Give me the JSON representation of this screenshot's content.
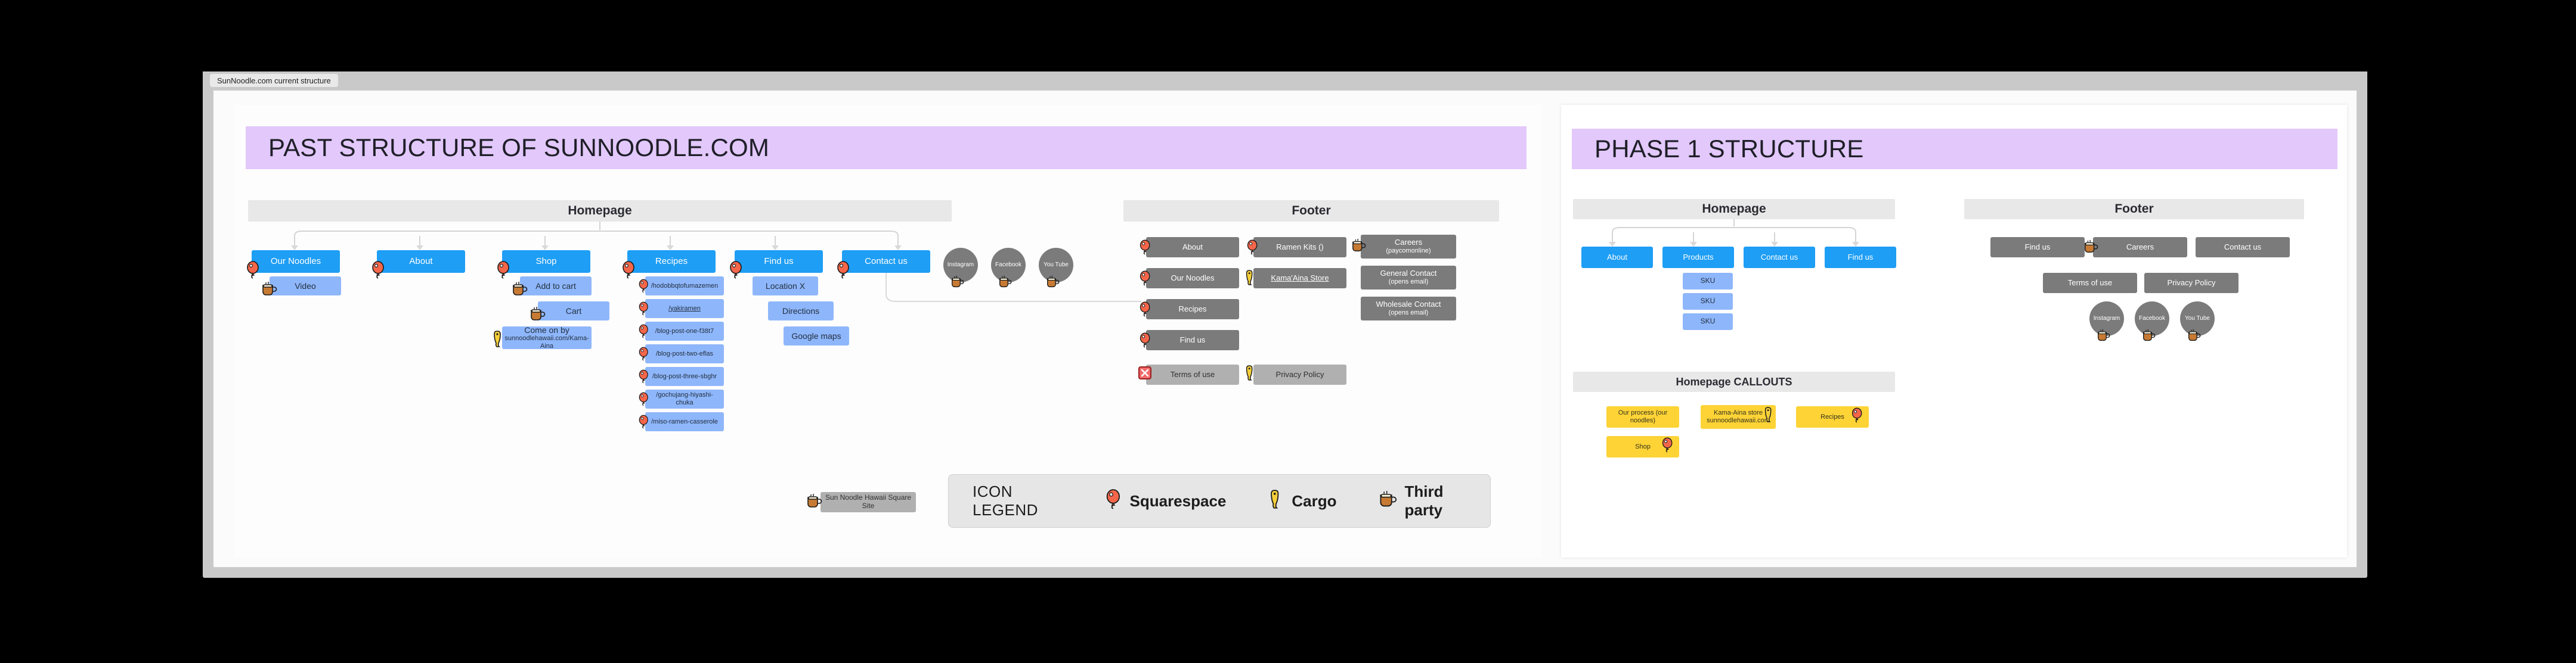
{
  "window": {
    "tab_label": "SunNoodle.com current structure"
  },
  "left_panel": {
    "title": "PAST STRUCTURE OF SUNNOODLE.COM",
    "homepage_header": "Homepage",
    "footer_header": "Footer",
    "columns": [
      {
        "root": "Our Noodles",
        "root_icon": "squarespace",
        "children": [
          {
            "label": "Video",
            "icon": "thirdparty"
          }
        ]
      },
      {
        "root": "About",
        "root_icon": "squarespace",
        "children": []
      },
      {
        "root": "Shop",
        "root_icon": "squarespace",
        "children": [
          {
            "label": "Add to cart",
            "icon": "thirdparty"
          },
          {
            "label": "Cart",
            "icon": "thirdparty"
          },
          {
            "label": "Come on by",
            "label2": "sunnoodlehawaii.com/Kama-Aina",
            "icon": "cargo"
          }
        ]
      },
      {
        "root": "Recipes",
        "root_icon": "squarespace",
        "children": [
          {
            "label": "/hodobbqtofumazemen",
            "icon": "squarespace"
          },
          {
            "label": "/yakiramen",
            "icon": "squarespace",
            "underline": true
          },
          {
            "label": "/blog-post-one-f38t7",
            "icon": "squarespace"
          },
          {
            "label": "/blog-post-two-eflas",
            "icon": "squarespace"
          },
          {
            "label": "/blog-post-three-sbghr",
            "icon": "squarespace"
          },
          {
            "label": "/gochujang-hiyashi-chuka",
            "icon": "squarespace"
          },
          {
            "label": "/miso-ramen-casserole",
            "icon": "squarespace"
          }
        ]
      },
      {
        "root": "Find us",
        "root_icon": "squarespace",
        "children": [
          {
            "label": "Location X",
            "icon": ""
          },
          {
            "label": "Directions",
            "icon": ""
          },
          {
            "label": "Google maps",
            "icon": ""
          }
        ]
      },
      {
        "root": "Contact us",
        "root_icon": "squarespace",
        "children": []
      }
    ],
    "socials": [
      {
        "label": "Instagram",
        "icon": "thirdparty"
      },
      {
        "label": "Facebook",
        "icon": "thirdparty"
      },
      {
        "label": "You Tube",
        "icon": "thirdparty"
      }
    ],
    "footer_col1": [
      {
        "label": "About",
        "icon": "squarespace"
      },
      {
        "label": "Our Noodles",
        "icon": "squarespace"
      },
      {
        "label": "Recipes",
        "icon": "squarespace"
      },
      {
        "label": "Find us",
        "icon": "squarespace"
      }
    ],
    "footer_col2": [
      {
        "label": "Ramen Kits ()",
        "icon": "squarespace"
      },
      {
        "label": "Kama'Aina Store",
        "icon": "cargo",
        "underline": true
      }
    ],
    "footer_col3": [
      {
        "label": "Careers",
        "label2": "(paycomonline)",
        "icon": "thirdparty"
      },
      {
        "label": "General Contact",
        "label2": "(opens email)",
        "icon": ""
      },
      {
        "label": "Wholesale Contact",
        "label2": "(opens email)",
        "icon": ""
      }
    ],
    "footer_bottom": [
      {
        "label": "Terms of use",
        "icon": "redx"
      },
      {
        "label": "Privacy Policy",
        "icon": "cargo"
      }
    ],
    "square_site": {
      "label": "Sun Noodle Hawaii Square Site",
      "icon": "thirdparty"
    },
    "legend": {
      "title": "ICON LEGEND",
      "items": [
        {
          "label": "Squarespace",
          "icon": "squarespace"
        },
        {
          "label": "Cargo",
          "icon": "cargo"
        },
        {
          "label": "Third party",
          "icon": "thirdparty"
        }
      ]
    }
  },
  "right_panel": {
    "title": "PHASE 1 STRUCTURE",
    "homepage_header": "Homepage",
    "footer_header": "Footer",
    "callouts_header": "Homepage CALLOUTS",
    "nav": [
      {
        "label": "About",
        "children": []
      },
      {
        "label": "Products",
        "children": [
          {
            "label": "SKU"
          },
          {
            "label": "SKU"
          },
          {
            "label": "SKU"
          }
        ]
      },
      {
        "label": "Contact us",
        "children": []
      },
      {
        "label": "Find us",
        "children": []
      }
    ],
    "callouts": [
      {
        "label": "Our process (our noodles)",
        "icon": ""
      },
      {
        "label": "Kama-Aina store",
        "label2": "sunnoodlehawaii.com",
        "icon": "cargo"
      },
      {
        "label": "Recipes",
        "icon": "squarespace"
      },
      {
        "label": "Shop",
        "icon": "squarespace"
      }
    ],
    "footer_row1": [
      {
        "label": "Find us",
        "icon": ""
      },
      {
        "label": "Careers",
        "icon": "thirdparty"
      },
      {
        "label": "Contact us",
        "icon": ""
      }
    ],
    "footer_row2": [
      {
        "label": "Terms of use",
        "icon": ""
      },
      {
        "label": "Privacy Policy",
        "icon": ""
      }
    ],
    "socials": [
      {
        "label": "Instagram",
        "icon": "thirdparty"
      },
      {
        "label": "Facebook",
        "icon": "thirdparty"
      },
      {
        "label": "You Tube",
        "icon": "thirdparty"
      }
    ]
  },
  "colors": {
    "banner": "#e2c8fb",
    "node_blue": "#1e9ef5",
    "node_light_blue": "#8eb6fb",
    "node_gray": "#7b7b7b",
    "node_yellow": "#fdd336",
    "group_header": "#e8e8e8"
  }
}
